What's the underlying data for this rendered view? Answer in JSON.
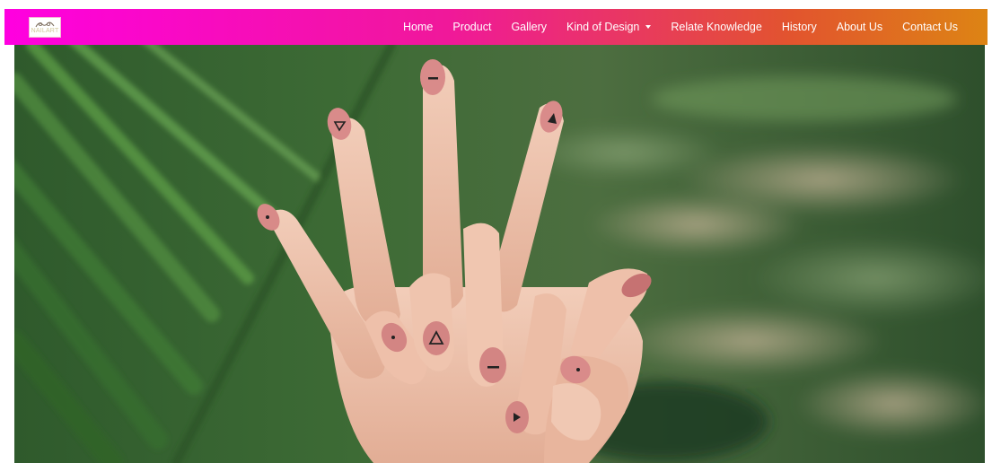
{
  "brand": {
    "logo_text": "NAILART",
    "logo_icon": "nail-polish-icon"
  },
  "nav": {
    "items": [
      {
        "label": "Home"
      },
      {
        "label": "Product"
      },
      {
        "label": "Gallery"
      },
      {
        "label": "Kind of Design",
        "dropdown": true
      },
      {
        "label": "Relate Knowledge"
      },
      {
        "label": "History"
      },
      {
        "label": "About Us"
      },
      {
        "label": "Contact Us"
      }
    ]
  },
  "colors": {
    "nav_gradient_start": "#ff00e0",
    "nav_gradient_end": "#dd8414",
    "nav_text": "#ffffff"
  },
  "hero": {
    "image_subject": "hands with geometric nail art over palm leaves"
  }
}
